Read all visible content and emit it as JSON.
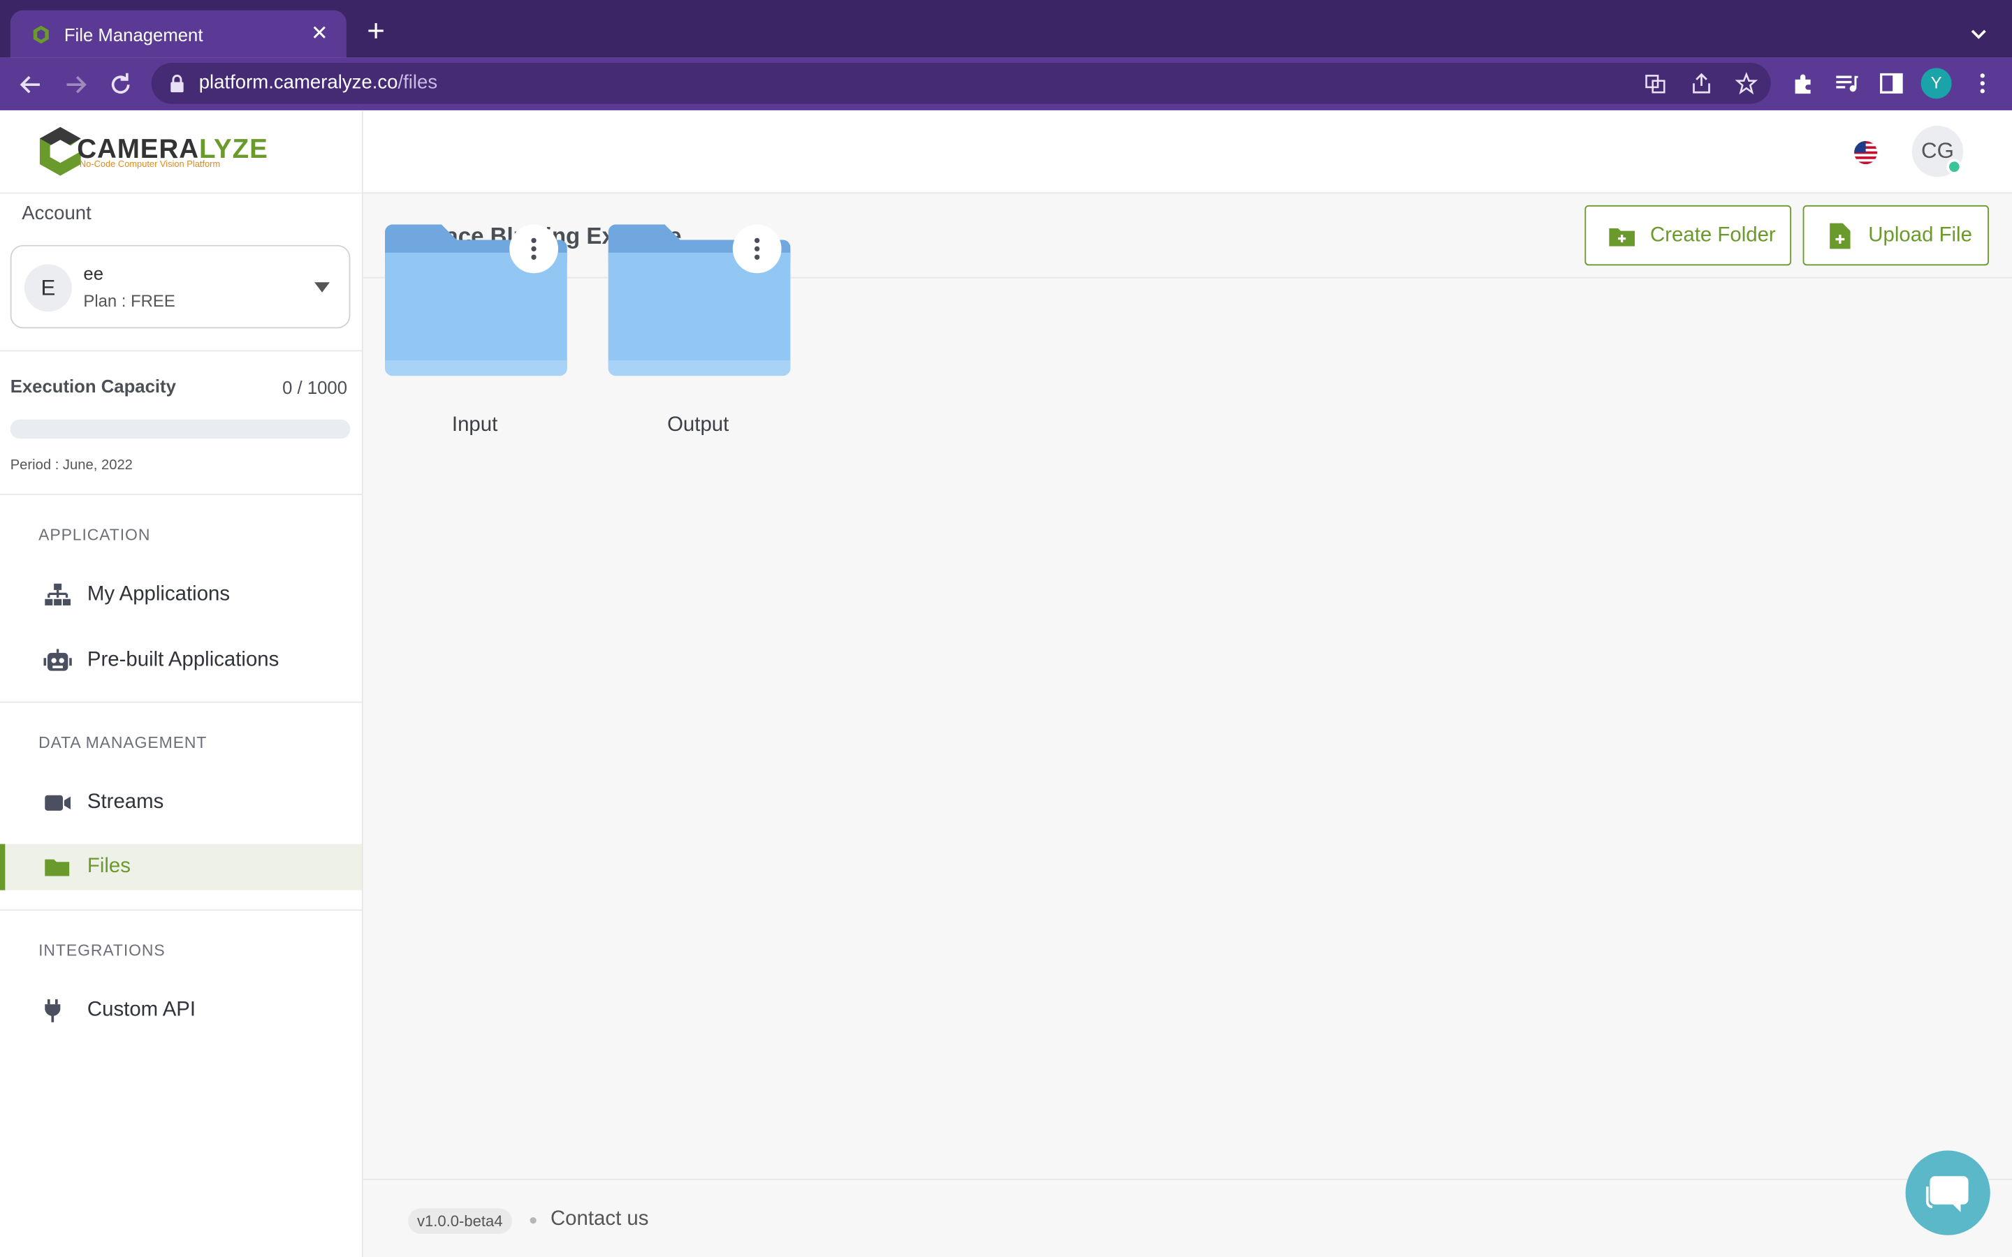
{
  "browser": {
    "tab_title": "File Management",
    "url_host": "platform.cameralyze.co",
    "url_path": "/files",
    "profile_initial": "Y"
  },
  "brand": {
    "name_main": "CAMERA",
    "name_accent": "LYZE",
    "tagline": "No-Code Computer Vision Platform",
    "accent_color": "#6a9a2b"
  },
  "sidebar": {
    "account_label": "Account",
    "account": {
      "initial": "E",
      "name": "ee",
      "plan": "Plan : FREE"
    },
    "capacity": {
      "label": "Execution Capacity",
      "value": "0 / 1000",
      "used_fraction": 0,
      "period": "Period : June, 2022"
    },
    "sections": [
      {
        "title": "APPLICATION",
        "items": [
          {
            "label": "My Applications",
            "icon": "sitemap-icon"
          },
          {
            "label": "Pre-built Applications",
            "icon": "robot-icon"
          }
        ]
      },
      {
        "title": "DATA MANAGEMENT",
        "items": [
          {
            "label": "Streams",
            "icon": "video-camera-icon"
          },
          {
            "label": "Files",
            "icon": "folder-icon",
            "active": true
          }
        ]
      },
      {
        "title": "INTEGRATIONS",
        "items": [
          {
            "label": "Custom API",
            "icon": "plug-icon"
          }
        ]
      }
    ]
  },
  "header": {
    "user_initials": "CG",
    "language_icon": "us-flag-icon"
  },
  "main": {
    "title": "Face Blurring Example",
    "create_folder_label": "Create Folder",
    "upload_file_label": "Upload File",
    "folders": [
      {
        "name": "Input"
      },
      {
        "name": "Output"
      }
    ]
  },
  "footer": {
    "version": "v1.0.0-beta4",
    "contact": "Contact us"
  }
}
